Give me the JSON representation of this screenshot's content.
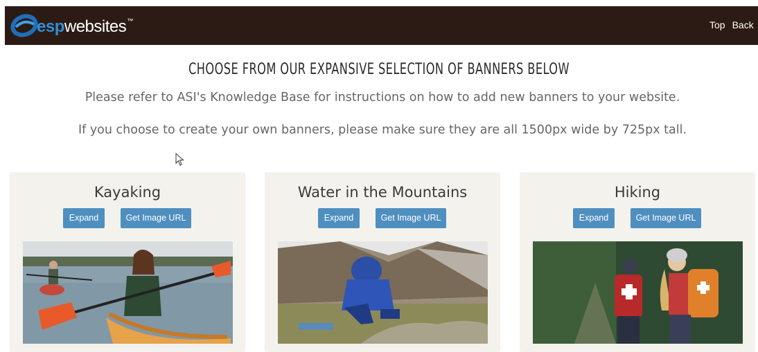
{
  "header": {
    "logo_esp": "esp",
    "logo_websites": "websites",
    "logo_tm": "™",
    "nav": [
      {
        "label": "Top"
      },
      {
        "label": "Back"
      }
    ]
  },
  "main": {
    "heading": "CHOOSE FROM OUR EXPANSIVE SELECTION OF BANNERS BELOW",
    "instructions": "Please refer to ASI's Knowledge Base for instructions on how to add new banners to your website.",
    "size_note": "If you choose to create your own banners, please make sure they are all 1500px wide by 725px tall."
  },
  "banners": [
    {
      "title": "Kayaking",
      "expand_label": "Expand",
      "url_label": "Get Image URL"
    },
    {
      "title": "Water in the Mountains",
      "expand_label": "Expand",
      "url_label": "Get Image URL"
    },
    {
      "title": "Hiking",
      "expand_label": "Expand",
      "url_label": "Get Image URL"
    }
  ],
  "colors": {
    "header_bg": "#2c1b14",
    "accent_blue": "#4f8fc0",
    "card_bg": "#f4f2ec"
  }
}
